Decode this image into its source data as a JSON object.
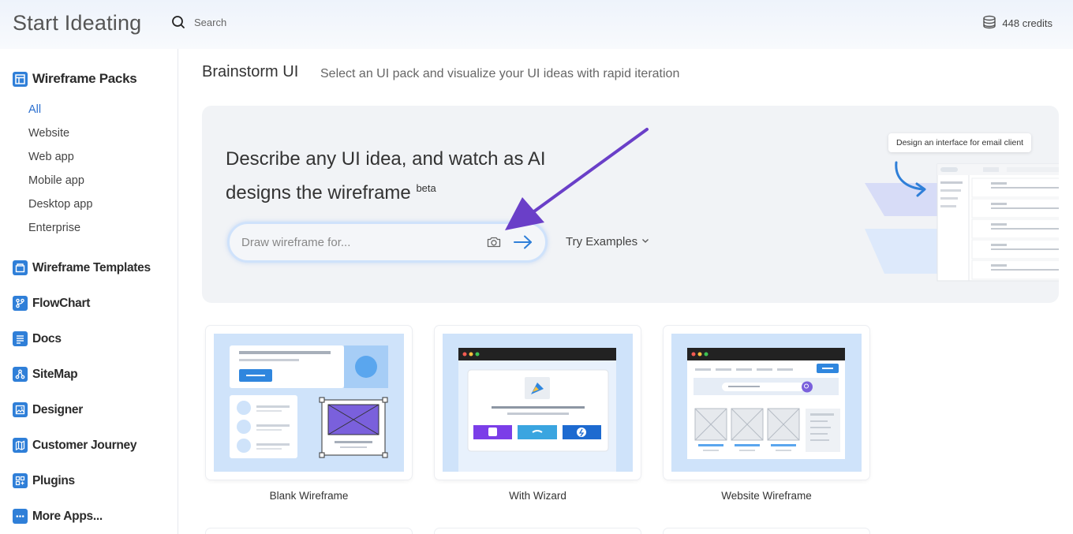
{
  "header": {
    "app_title": "Start Ideating",
    "search_placeholder": "Search",
    "credits": "448 credits"
  },
  "sidebar": {
    "packs_title": "Wireframe Packs",
    "pack_items": [
      {
        "label": "All",
        "active": true
      },
      {
        "label": "Website",
        "active": false
      },
      {
        "label": "Web app",
        "active": false
      },
      {
        "label": "Mobile app",
        "active": false
      },
      {
        "label": "Desktop app",
        "active": false
      },
      {
        "label": "Enterprise",
        "active": false
      }
    ],
    "sections": [
      {
        "label": "Wireframe Templates",
        "icon": "template-icon"
      },
      {
        "label": "FlowChart",
        "icon": "flowchart-icon"
      },
      {
        "label": "Docs",
        "icon": "docs-icon"
      },
      {
        "label": "SiteMap",
        "icon": "sitemap-icon"
      },
      {
        "label": "Designer",
        "icon": "image-icon"
      },
      {
        "label": "Customer Journey",
        "icon": "map-icon"
      },
      {
        "label": "Plugins",
        "icon": "plugins-icon"
      },
      {
        "label": "More Apps...",
        "icon": "more-icon"
      }
    ]
  },
  "main": {
    "title": "Brainstorm UI",
    "subtitle": "Select an UI pack and visualize your UI ideas with rapid iteration",
    "hero": {
      "heading": "Describe any UI idea, and watch as AI designs the wireframe",
      "badge": "beta",
      "prompt_placeholder": "Draw wireframe for...",
      "try_examples": "Try Examples",
      "illustration_tag": "Design an interface for email client"
    },
    "cards": [
      {
        "label": "Blank Wireframe"
      },
      {
        "label": "With Wizard"
      },
      {
        "label": "Website Wireframe"
      }
    ]
  },
  "colors": {
    "accent": "#2f7fd8",
    "active_link": "#2a6fcf",
    "annotation_arrow": "#6a3fc8"
  }
}
